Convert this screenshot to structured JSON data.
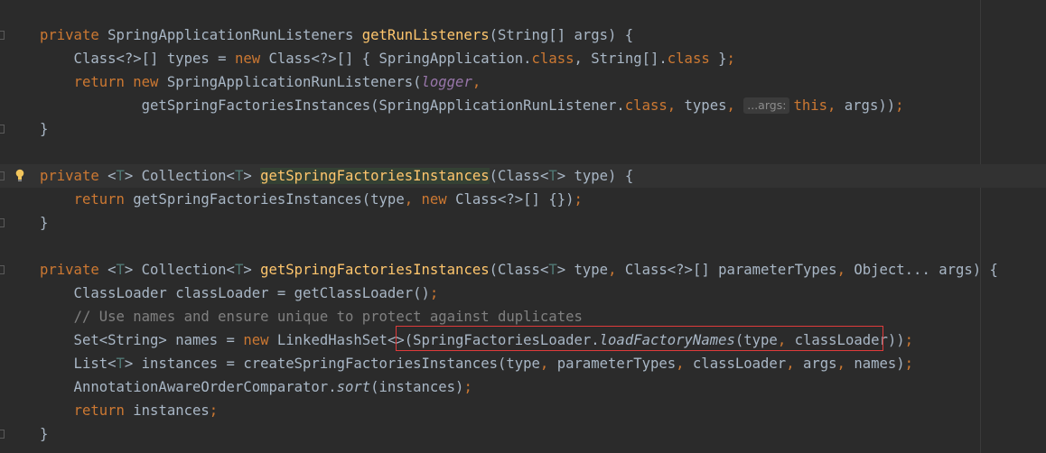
{
  "editor": {
    "lines": [
      {
        "tokens": [
          {
            "t": "private ",
            "c": "kw"
          },
          {
            "t": "SpringApplicationRunListeners "
          },
          {
            "t": "getRunListeners",
            "c": "fn"
          },
          {
            "t": "(String[] args) {"
          }
        ]
      },
      {
        "tokens": [
          {
            "t": "    Class<?>[] types = "
          },
          {
            "t": "new ",
            "c": "kw"
          },
          {
            "t": "Class<?>[] { SpringApplication."
          },
          {
            "t": "class",
            "c": "kw"
          },
          {
            "t": ", String[]."
          },
          {
            "t": "class ",
            "c": "kw"
          },
          {
            "t": "}"
          },
          {
            "t": ";",
            "c": "kw"
          }
        ]
      },
      {
        "tokens": [
          {
            "t": "    "
          },
          {
            "t": "return new ",
            "c": "kw"
          },
          {
            "t": "SpringApplicationRunListeners("
          },
          {
            "t": "logger",
            "c": "fld"
          },
          {
            "t": ",",
            "c": "kw"
          }
        ]
      },
      {
        "tokens": [
          {
            "t": "            getSpringFactoriesInstances(SpringApplicationRunListener."
          },
          {
            "t": "class",
            "c": "kw"
          },
          {
            "t": ", ",
            "c": "kw"
          },
          {
            "t": "types"
          },
          {
            "t": ", ",
            "c": "kw"
          },
          {
            "t": "...args:",
            "c": "hint"
          },
          {
            "t": "this",
            "c": "kw"
          },
          {
            "t": ", ",
            "c": "kw"
          },
          {
            "t": "args))"
          },
          {
            "t": ";",
            "c": "kw"
          }
        ]
      },
      {
        "tokens": [
          {
            "t": "}"
          }
        ]
      },
      {
        "tokens": []
      },
      {
        "tokens": [
          {
            "t": "private ",
            "c": "kw"
          },
          {
            "t": "<"
          },
          {
            "t": "T",
            "c": "tp"
          },
          {
            "t": "> Collection<"
          },
          {
            "t": "T",
            "c": "tp"
          },
          {
            "t": "> "
          },
          {
            "t": "getSpringFactoriesInstances",
            "c": "fn hl"
          },
          {
            "t": "(Class<"
          },
          {
            "t": "T",
            "c": "tp"
          },
          {
            "t": "> type) {"
          }
        ]
      },
      {
        "tokens": [
          {
            "t": "    "
          },
          {
            "t": "return ",
            "c": "kw"
          },
          {
            "t": "getSpringFactoriesInstances(type"
          },
          {
            "t": ", ",
            "c": "kw"
          },
          {
            "t": "new ",
            "c": "kw"
          },
          {
            "t": "Class<?>[] {})"
          },
          {
            "t": ";",
            "c": "kw"
          }
        ]
      },
      {
        "tokens": [
          {
            "t": "}"
          }
        ]
      },
      {
        "tokens": []
      },
      {
        "tokens": [
          {
            "t": "private ",
            "c": "kw"
          },
          {
            "t": "<"
          },
          {
            "t": "T",
            "c": "tp"
          },
          {
            "t": "> Collection<"
          },
          {
            "t": "T",
            "c": "tp"
          },
          {
            "t": "> "
          },
          {
            "t": "getSpringFactoriesInstances",
            "c": "fn"
          },
          {
            "t": "(Class<"
          },
          {
            "t": "T",
            "c": "tp"
          },
          {
            "t": "> type"
          },
          {
            "t": ", ",
            "c": "kw"
          },
          {
            "t": "Class<?>[] parameterTypes"
          },
          {
            "t": ", ",
            "c": "kw"
          },
          {
            "t": "Object... args) {"
          }
        ]
      },
      {
        "tokens": [
          {
            "t": "    ClassLoader classLoader = getClassLoader()"
          },
          {
            "t": ";",
            "c": "kw"
          }
        ]
      },
      {
        "tokens": [
          {
            "t": "    "
          },
          {
            "t": "// Use names and ensure unique to protect against duplicates",
            "c": "cm"
          }
        ]
      },
      {
        "tokens": [
          {
            "t": "    Set<String> names = "
          },
          {
            "t": "new ",
            "c": "kw"
          },
          {
            "t": "LinkedHashSet<>(SpringFactoriesLoader."
          },
          {
            "t": "loadFactoryNames",
            "c": "it"
          },
          {
            "t": "(type"
          },
          {
            "t": ", ",
            "c": "kw"
          },
          {
            "t": "classLoader))"
          },
          {
            "t": ";",
            "c": "kw"
          }
        ]
      },
      {
        "tokens": [
          {
            "t": "    List<"
          },
          {
            "t": "T",
            "c": "tp"
          },
          {
            "t": "> instances = createSpringFactoriesInstances(type"
          },
          {
            "t": ", ",
            "c": "kw"
          },
          {
            "t": "parameterTypes"
          },
          {
            "t": ", ",
            "c": "kw"
          },
          {
            "t": "classLoader"
          },
          {
            "t": ", ",
            "c": "kw"
          },
          {
            "t": "args"
          },
          {
            "t": ", ",
            "c": "kw"
          },
          {
            "t": "names)"
          },
          {
            "t": ";",
            "c": "kw"
          }
        ]
      },
      {
        "tokens": [
          {
            "t": "    AnnotationAwareOrderComparator."
          },
          {
            "t": "sort",
            "c": "it"
          },
          {
            "t": "(instances)"
          },
          {
            "t": ";",
            "c": "kw"
          }
        ]
      },
      {
        "tokens": [
          {
            "t": "    "
          },
          {
            "t": "return ",
            "c": "kw"
          },
          {
            "t": "instances"
          },
          {
            "t": ";",
            "c": "kw"
          }
        ]
      },
      {
        "tokens": [
          {
            "t": "}"
          }
        ]
      }
    ],
    "current_line": 6,
    "fold_lines": [
      0,
      4,
      6,
      8,
      10,
      17
    ],
    "bulb_line": 6
  },
  "colors": {
    "background": "#2b2b2b",
    "keyword": "#cc7832",
    "method_declaration": "#ffc66d",
    "type_parameter": "#507874",
    "field": "#9876aa",
    "comment": "#808080",
    "plain": "#a9b7c6",
    "annotation_box": "#e03b3b"
  },
  "icons": {
    "intention_bulb": "lightbulb-icon",
    "fold_marker": "fold-icon"
  }
}
